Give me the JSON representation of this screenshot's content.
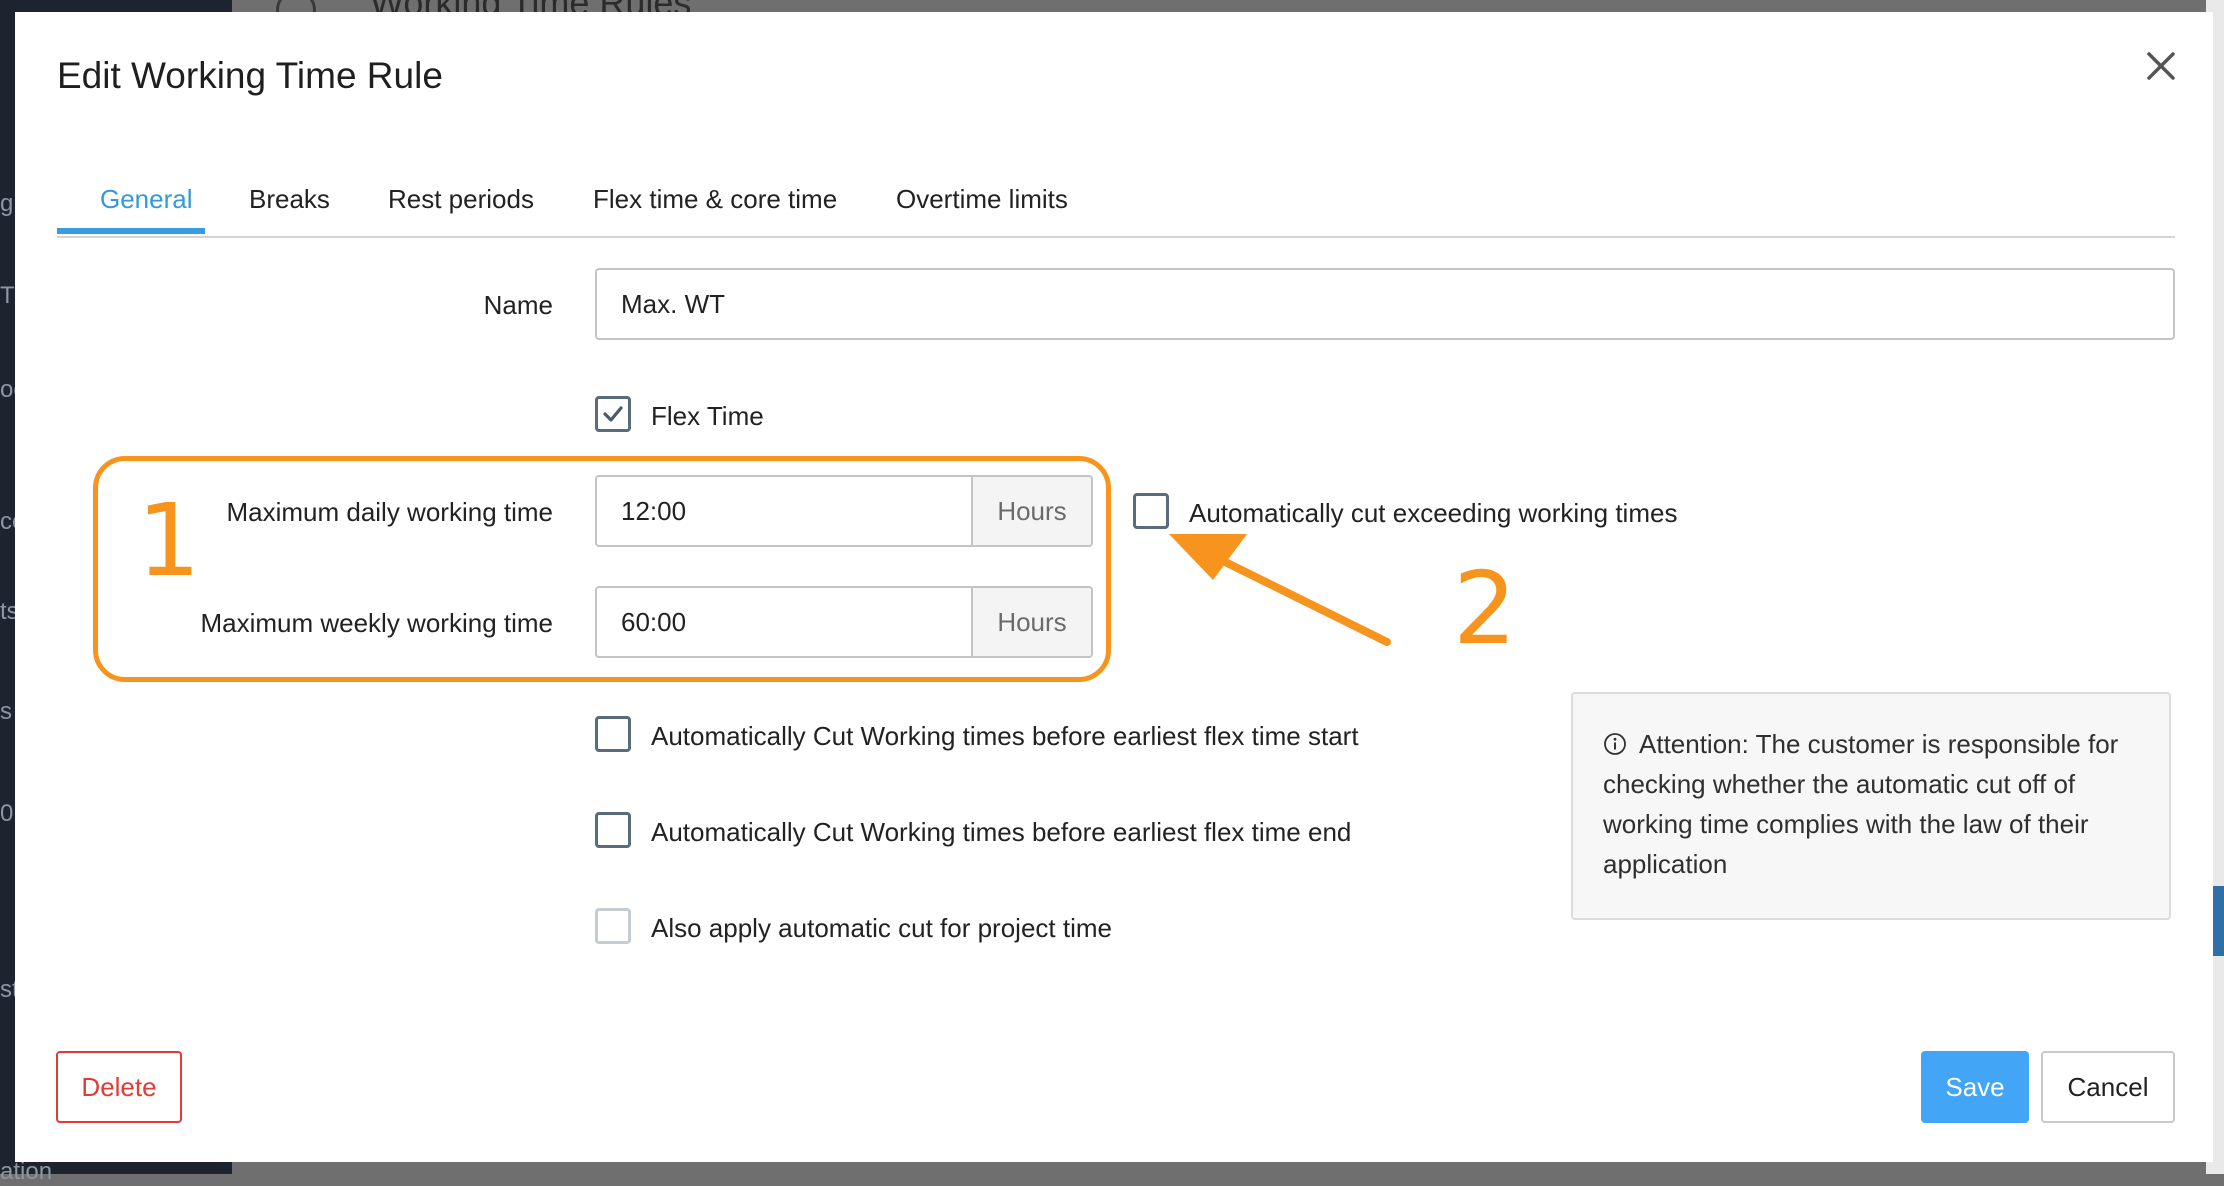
{
  "background": {
    "header_text": "Working Time Rules",
    "sidebar_fragments": [
      "g",
      "T",
      "og",
      "cc",
      "ts",
      "s",
      "0",
      "st",
      "ation"
    ]
  },
  "dialog": {
    "title": "Edit Working Time Rule",
    "close_icon": "close-icon"
  },
  "tabs": [
    {
      "label": "General",
      "active": true
    },
    {
      "label": "Breaks",
      "active": false
    },
    {
      "label": "Rest periods",
      "active": false
    },
    {
      "label": "Flex time & core time",
      "active": false
    },
    {
      "label": "Overtime limits",
      "active": false
    }
  ],
  "form": {
    "name_label": "Name",
    "name_value": "Max. WT",
    "flex_time": {
      "label": "Flex Time",
      "checked": true
    },
    "max_daily": {
      "label": "Maximum daily working time",
      "value": "12:00",
      "unit": "Hours"
    },
    "max_weekly": {
      "label": "Maximum weekly working time",
      "value": "60:00",
      "unit": "Hours"
    },
    "auto_cut_exceeding": {
      "label": "Automatically cut exceeding working times",
      "checked": false
    },
    "cut_before_flex_start": {
      "label": "Automatically Cut Working times before earliest flex time start",
      "checked": false
    },
    "cut_before_flex_end": {
      "label": "Automatically Cut Working times before earliest flex time end",
      "checked": false
    },
    "apply_project_time": {
      "label": "Also apply automatic cut for project time",
      "checked": false,
      "disabled": true
    }
  },
  "info_box": {
    "icon": "info-icon",
    "text": "Attention: The customer is responsible for checking whether the automatic cut off of working time complies with the law of their application"
  },
  "annotations": {
    "marker_1": "1",
    "marker_2": "2",
    "color": "#f7941d"
  },
  "buttons": {
    "delete": "Delete",
    "save": "Save",
    "cancel": "Cancel"
  },
  "colors": {
    "accent": "#3498db",
    "danger": "#e53935",
    "save_bg": "#42a5f5"
  }
}
